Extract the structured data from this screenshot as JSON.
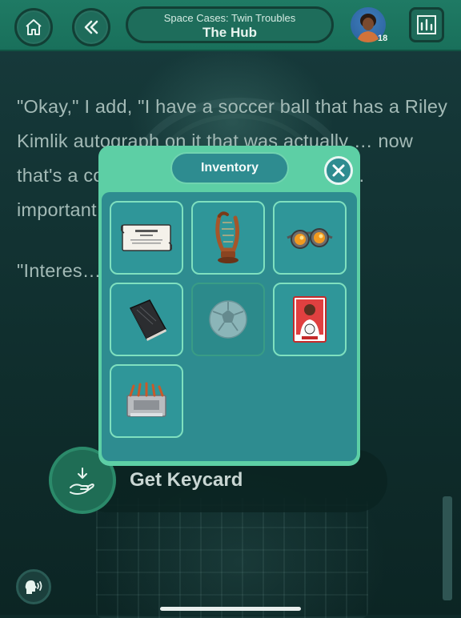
{
  "header": {
    "subtitle": "Space Cases: Twin Troubles",
    "title": "The Hub",
    "avatar_level": "18",
    "icons": {
      "home": "home-icon",
      "back": "double-chevron-left-icon",
      "stats": "chart-icon"
    }
  },
  "story": {
    "paragraph1": "\"Okay,\" I add, \"I have a soccer ball that has a Riley Kimlik autograph on it that was actually … now that's a collect… …osed to be evide… … important…",
    "paragraph2": "\"Interes… … might be valu…"
  },
  "action": {
    "label": "Get Keycard",
    "icon": "hand-receive-icon"
  },
  "inventory": {
    "title": "Inventory",
    "items": [
      {
        "name": "scroll-card",
        "dimmed": false
      },
      {
        "name": "lyre-harp",
        "dimmed": false
      },
      {
        "name": "goggles",
        "dimmed": false
      },
      {
        "name": "book",
        "dimmed": false
      },
      {
        "name": "soccer-ball",
        "dimmed": true
      },
      {
        "name": "player-card",
        "dimmed": false
      },
      {
        "name": "keycard-machine",
        "dimmed": false
      }
    ]
  },
  "colors": {
    "header_bg": "#1f7a64",
    "modal_bg": "#5dcfa5",
    "modal_inner": "#2e8c90",
    "story_text": "#a3bab6"
  }
}
